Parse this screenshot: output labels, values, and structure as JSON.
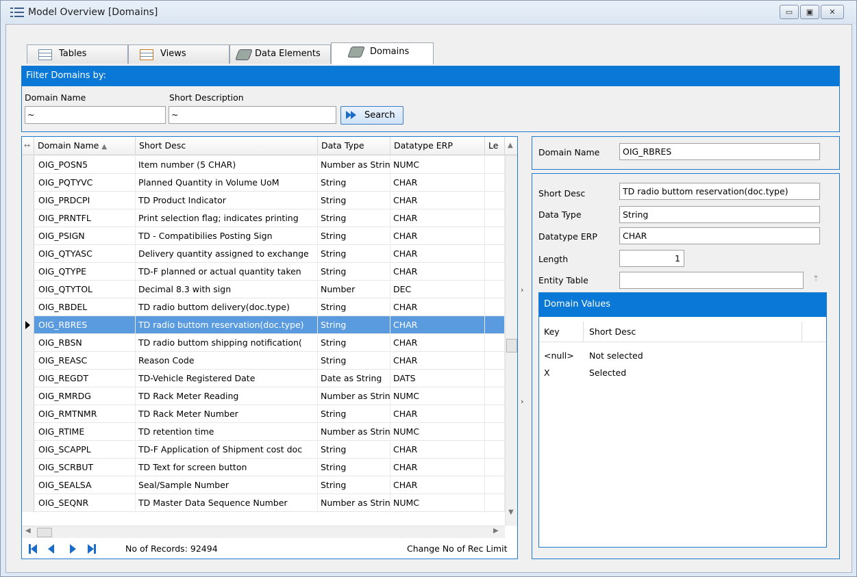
{
  "window": {
    "title": "Model Overview [Domains]",
    "buttons": {
      "minimize": "▭",
      "maximize": "▣",
      "close": "✕"
    }
  },
  "tabs": [
    {
      "label": "Tables",
      "icon": "table-icon"
    },
    {
      "label": "Views",
      "icon": "view-icon"
    },
    {
      "label": "Data Elements",
      "icon": "data-element-icon"
    },
    {
      "label": "Domains",
      "icon": "domain-icon",
      "active": true
    }
  ],
  "filter": {
    "header": "Filter Domains by:",
    "domain_name_label": "Domain Name",
    "domain_name_value": "~",
    "short_desc_label": "Short Description",
    "short_desc_value": "~",
    "search_label": "Search"
  },
  "grid": {
    "columns": [
      "Domain Name",
      "Short Desc",
      "Data Type",
      "Datatype ERP",
      "Le"
    ],
    "rows": [
      [
        "OIG_POSN5",
        "Item number (5 CHAR)",
        "Number as String",
        "NUMC"
      ],
      [
        "OIG_PQTYVC",
        "Planned Quantity in Volume UoM",
        "String",
        "CHAR"
      ],
      [
        "OIG_PRDCPI",
        "TD Product Indicator",
        "String",
        "CHAR"
      ],
      [
        "OIG_PRNTFL",
        "Print selection flag; indicates printing",
        "String",
        "CHAR"
      ],
      [
        "OIG_PSIGN",
        "TD - Compatibilies Posting Sign",
        "String",
        "CHAR"
      ],
      [
        "OIG_QTYASC",
        "Delivery quantity assigned to exchange",
        "String",
        "CHAR"
      ],
      [
        "OIG_QTYPE",
        "TD-F planned or actual quantity taken",
        "String",
        "CHAR"
      ],
      [
        "OIG_QTYTOL",
        "Decimal 8.3 with sign",
        "Number",
        "DEC"
      ],
      [
        "OIG_RBDEL",
        "TD radio buttom delivery(doc.type)",
        "String",
        "CHAR"
      ],
      [
        "OIG_RBRES",
        "TD radio buttom reservation(doc.type)",
        "String",
        "CHAR"
      ],
      [
        "OIG_RBSN",
        "TD radio buttom shipping notification(",
        "String",
        "CHAR"
      ],
      [
        "OIG_REASC",
        "Reason Code",
        "String",
        "CHAR"
      ],
      [
        "OIG_REGDT",
        "TD-Vehicle Registered Date",
        "Date as String",
        "DATS"
      ],
      [
        "OIG_RMRDG",
        "TD Rack Meter Reading",
        "Number as String",
        "NUMC"
      ],
      [
        "OIG_RMTNMR",
        "TD Rack Meter Number",
        "String",
        "CHAR"
      ],
      [
        "OIG_RTIME",
        "TD retention time",
        "Number as String",
        "NUMC"
      ],
      [
        "OIG_SCAPPL",
        "TD-F Application of Shipment cost doc",
        "String",
        "CHAR"
      ],
      [
        "OIG_SCRBUT",
        "TD  Text for screen button",
        "String",
        "CHAR"
      ],
      [
        "OIG_SEALSA",
        "Seal/Sample Number",
        "String",
        "CHAR"
      ],
      [
        "OIG_SEQNR",
        "TD Master Data Sequence Number",
        "Number as String",
        "NUMC"
      ]
    ],
    "selected_index": 9,
    "records_text": "No of Records: 92494",
    "change_limit_label": "Change No of Rec Limit"
  },
  "detail": {
    "domain_name_label": "Domain Name",
    "domain_name_value": "OIG_RBRES",
    "short_desc_label": "Short Desc",
    "short_desc_value": "TD radio buttom reservation(doc.type)",
    "data_type_label": "Data Type",
    "data_type_value": "String",
    "datatype_erp_label": "Datatype ERP",
    "datatype_erp_value": "CHAR",
    "length_label": "Length",
    "length_value": "1",
    "entity_table_label": "Entity Table",
    "entity_table_value": "",
    "domain_values": {
      "header": "Domain Values",
      "col_key": "Key",
      "col_desc": "Short Desc",
      "rows": [
        {
          "key": "<null>",
          "desc": "Not selected"
        },
        {
          "key": "X",
          "desc": "Selected"
        }
      ]
    }
  },
  "colors": {
    "accent": "#0a78d7",
    "selection": "#5a9be0"
  }
}
